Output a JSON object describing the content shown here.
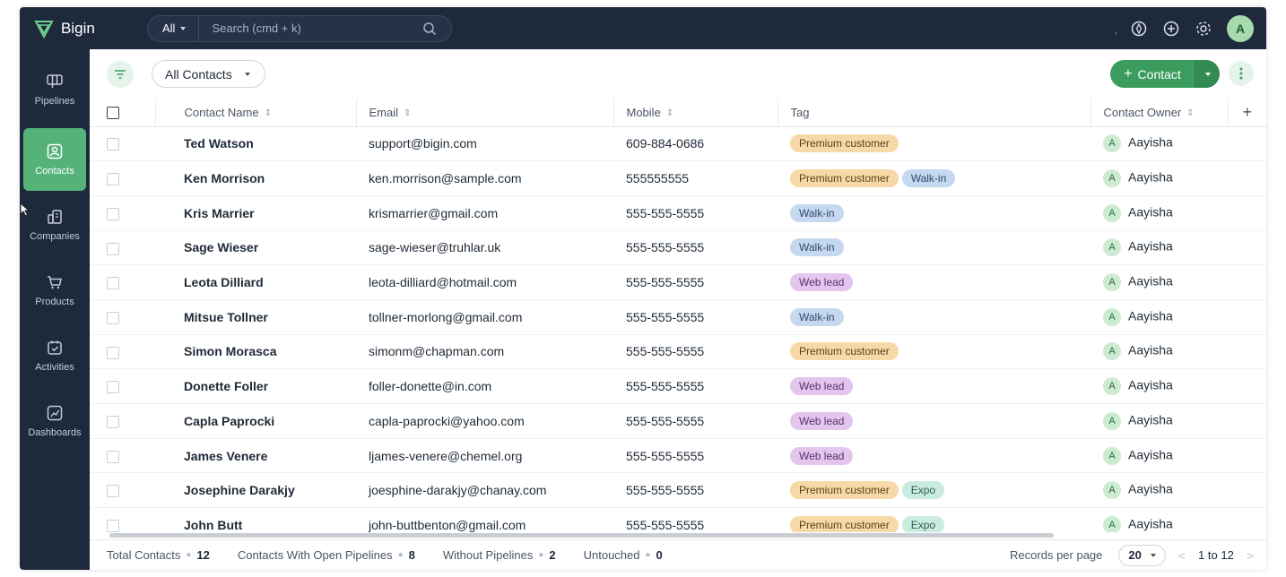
{
  "app": {
    "brand": "Bigin"
  },
  "colors": {
    "accent": "#3b9c5e",
    "sidebar": "#1e2a3b"
  },
  "search": {
    "scope": "All",
    "placeholder": "Search (cmd + k)"
  },
  "topbar": {
    "separator": ",",
    "avatar_initial": "A"
  },
  "sidebar": {
    "items": [
      {
        "label": "Pipelines",
        "icon": "pipelines-icon"
      },
      {
        "label": "Contacts",
        "icon": "contacts-icon",
        "active": true
      },
      {
        "label": "Companies",
        "icon": "companies-icon"
      },
      {
        "label": "Products",
        "icon": "products-icon"
      },
      {
        "label": "Activities",
        "icon": "activities-icon"
      },
      {
        "label": "Dashboards",
        "icon": "dashboards-icon"
      }
    ]
  },
  "toolbar": {
    "view": "All Contacts",
    "add_button": "Contact"
  },
  "table": {
    "columns": [
      "Contact Name",
      "Email",
      "Mobile",
      "Tag",
      "Contact Owner"
    ],
    "add_column": "+",
    "rows": [
      {
        "name": "Ted Watson",
        "email": "support@bigin.com",
        "mobile": "609-884-0686",
        "tags": [
          "Premium customer"
        ],
        "owner": "Aayisha"
      },
      {
        "name": "Ken Morrison",
        "email": "ken.morrison@sample.com",
        "mobile": "555555555",
        "tags": [
          "Premium customer",
          "Walk-in"
        ],
        "owner": "Aayisha"
      },
      {
        "name": "Kris Marrier",
        "email": "krismarrier@gmail.com",
        "mobile": "555-555-5555",
        "tags": [
          "Walk-in"
        ],
        "owner": "Aayisha"
      },
      {
        "name": "Sage Wieser",
        "email": "sage-wieser@truhlar.uk",
        "mobile": "555-555-5555",
        "tags": [
          "Walk-in"
        ],
        "owner": "Aayisha"
      },
      {
        "name": "Leota Dilliard",
        "email": "leota-dilliard@hotmail.com",
        "mobile": "555-555-5555",
        "tags": [
          "Web lead"
        ],
        "owner": "Aayisha"
      },
      {
        "name": "Mitsue Tollner",
        "email": "tollner-morlong@gmail.com",
        "mobile": "555-555-5555",
        "tags": [
          "Walk-in"
        ],
        "owner": "Aayisha"
      },
      {
        "name": "Simon Morasca",
        "email": "simonm@chapman.com",
        "mobile": "555-555-5555",
        "tags": [
          "Premium customer"
        ],
        "owner": "Aayisha"
      },
      {
        "name": "Donette Foller",
        "email": "foller-donette@in.com",
        "mobile": "555-555-5555",
        "tags": [
          "Web lead"
        ],
        "owner": "Aayisha"
      },
      {
        "name": "Capla Paprocki",
        "email": "capla-paprocki@yahoo.com",
        "mobile": "555-555-5555",
        "tags": [
          "Web lead"
        ],
        "owner": "Aayisha"
      },
      {
        "name": "James Venere",
        "email": "ljames-venere@chemel.org",
        "mobile": "555-555-5555",
        "tags": [
          "Web lead"
        ],
        "owner": "Aayisha"
      },
      {
        "name": "Josephine Darakjy",
        "email": "joesphine-darakjy@chanay.com",
        "mobile": "555-555-5555",
        "tags": [
          "Premium customer",
          "Expo"
        ],
        "owner": "Aayisha"
      },
      {
        "name": "John Butt",
        "email": "john-buttbenton@gmail.com",
        "mobile": "555-555-5555",
        "tags": [
          "Premium customer",
          "Expo"
        ],
        "owner": "Aayisha"
      }
    ],
    "owner_initial": "A"
  },
  "tag_colors": {
    "Premium customer": {
      "bg": "#f6d9a6",
      "fg": "#5a4216"
    },
    "Walk-in": {
      "bg": "#c6d8ef",
      "fg": "#2d4a6e"
    },
    "Web lead": {
      "bg": "#e2c6ee",
      "fg": "#5b2f6e"
    },
    "Expo": {
      "bg": "#c9ebe0",
      "fg": "#2b5f4e"
    }
  },
  "footer": {
    "stats": [
      {
        "label": "Total Contacts",
        "value": "12"
      },
      {
        "label": "Contacts With Open Pipelines",
        "value": "8"
      },
      {
        "label": "Without Pipelines",
        "value": "2"
      },
      {
        "label": "Untouched",
        "value": "0"
      }
    ],
    "records_per_page_label": "Records per page",
    "records_per_page": "20",
    "range": "1 to 12"
  }
}
